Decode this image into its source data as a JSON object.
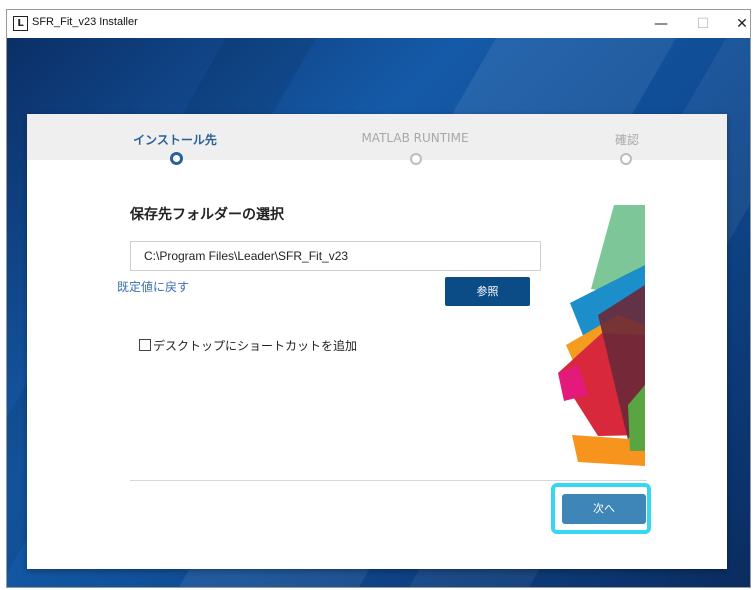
{
  "window": {
    "title": "SFR_Fit_v23 Installer",
    "icon_letter": "L",
    "controls": {
      "minimize": "—",
      "maximize": "☐",
      "close": "✕"
    }
  },
  "steps": [
    {
      "label": "インストール先",
      "state": "active"
    },
    {
      "label": "MATLAB RUNTIME",
      "state": "inactive"
    },
    {
      "label": "確認",
      "state": "inactive"
    }
  ],
  "form": {
    "heading": "保存先フォルダーの選択",
    "path_value": "C:\\Program Files\\Leader\\SFR_Fit_v23",
    "reset_link": "既定値に戻す",
    "browse_button": "参照",
    "shortcut_checkbox": {
      "label": "デスクトップにショートカットを追加",
      "checked": false
    },
    "next_button": "次へ"
  },
  "colors": {
    "accent": "#2a5f97",
    "browse_button_bg": "#0b4b86",
    "next_button_bg": "#3d86b7",
    "highlight": "#35d8ef",
    "link": "#3b6fb0"
  }
}
